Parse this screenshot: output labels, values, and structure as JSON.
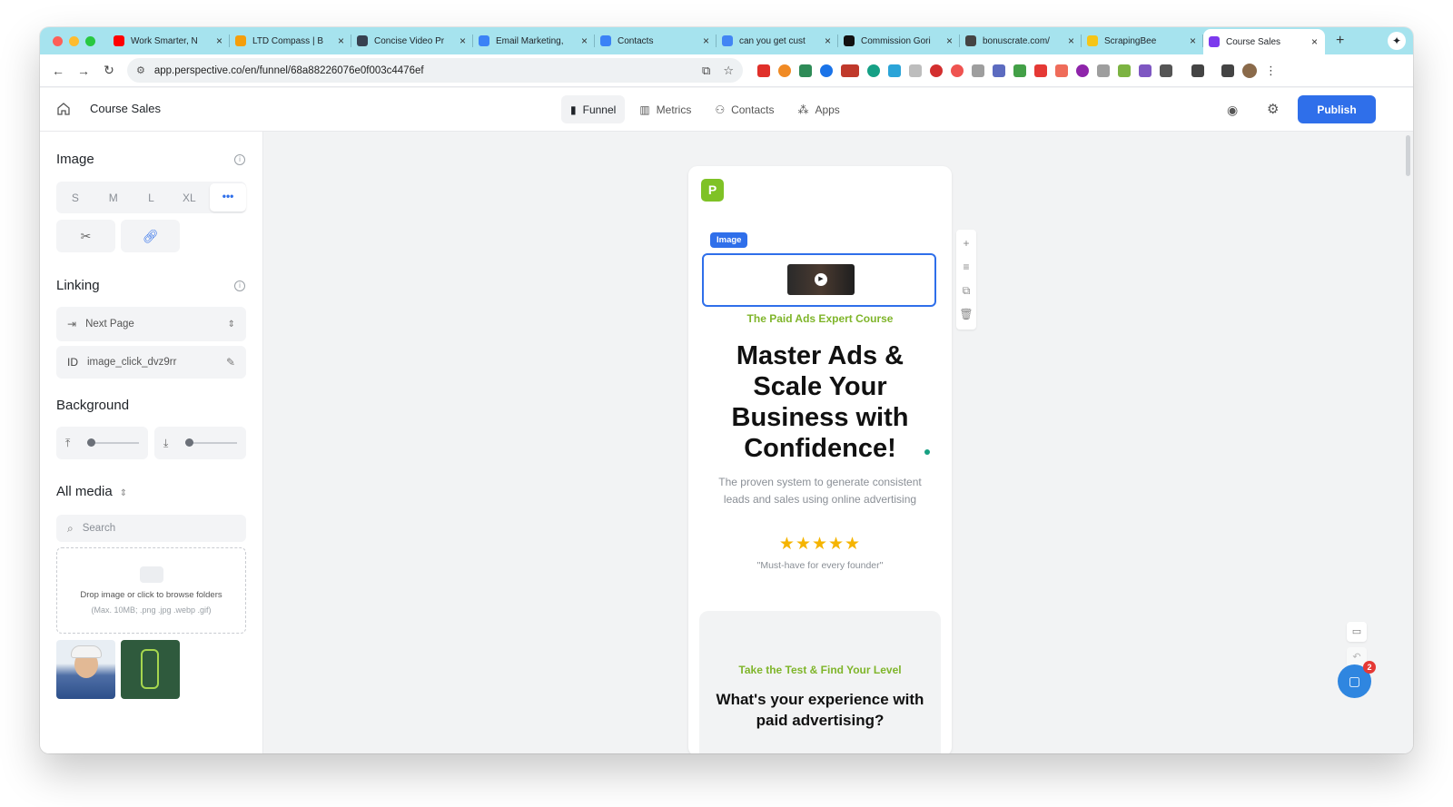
{
  "browser": {
    "tabs": [
      {
        "title": "Work Smarter, N",
        "favicon_color": "#ff0000"
      },
      {
        "title": "LTD Compass | B",
        "favicon_color": "#f59e0b"
      },
      {
        "title": "Concise Video Pr",
        "favicon_color": "#374151"
      },
      {
        "title": "Email Marketing,",
        "favicon_color": "#3b82f6"
      },
      {
        "title": "Contacts",
        "favicon_color": "#3b82f6"
      },
      {
        "title": "can you get cust",
        "favicon_color": "#4285f4"
      },
      {
        "title": "Commission Gori",
        "favicon_color": "#111111"
      },
      {
        "title": "bonuscrate.com/",
        "favicon_color": "#444444"
      },
      {
        "title": "ScrapingBee",
        "favicon_color": "#f5c518"
      },
      {
        "title": "Course Sales",
        "favicon_color": "#7c3aed",
        "active": true
      }
    ],
    "url": "app.perspective.co/en/funnel/68a88226076e0f003c4476ef"
  },
  "header": {
    "title": "Course Sales",
    "nav": [
      {
        "label": "Funnel",
        "icon": "funnel-icon",
        "active": true
      },
      {
        "label": "Metrics",
        "icon": "bar-chart-icon"
      },
      {
        "label": "Contacts",
        "icon": "people-icon"
      },
      {
        "label": "Apps",
        "icon": "apps-icon"
      }
    ],
    "publish_label": "Publish",
    "accent_color": "#2f6fea"
  },
  "sidebar": {
    "image_title": "Image",
    "sizes": [
      "S",
      "M",
      "L",
      "XL",
      "•••"
    ],
    "linking_title": "Linking",
    "link_target": "Next Page",
    "id_label": "ID",
    "id_value": "image_click_dvz9rr",
    "background_title": "Background",
    "media_title": "All media",
    "search_placeholder": "Search",
    "drop_line1": "Drop image or click to browse folders",
    "drop_line2": "(Max. 10MB; .png .jpg .webp .gif)"
  },
  "preview": {
    "logo_letter": "P",
    "image_badge": "Image",
    "kicker": "The Paid Ads Expert Course",
    "headline": "Master Ads & Scale Your Business with Confidence!",
    "subtext": "The proven system to generate consistent leads and sales using online advertising",
    "stars": "★★★★★",
    "rating_value": 5,
    "quote": "\"Must-have for every founder\"",
    "card_kicker": "Take the Test & Find Your Level",
    "card_question": "What's your experience with paid advertising?",
    "brand_green": "#7fb52a"
  },
  "chat": {
    "badge_count": "2"
  }
}
